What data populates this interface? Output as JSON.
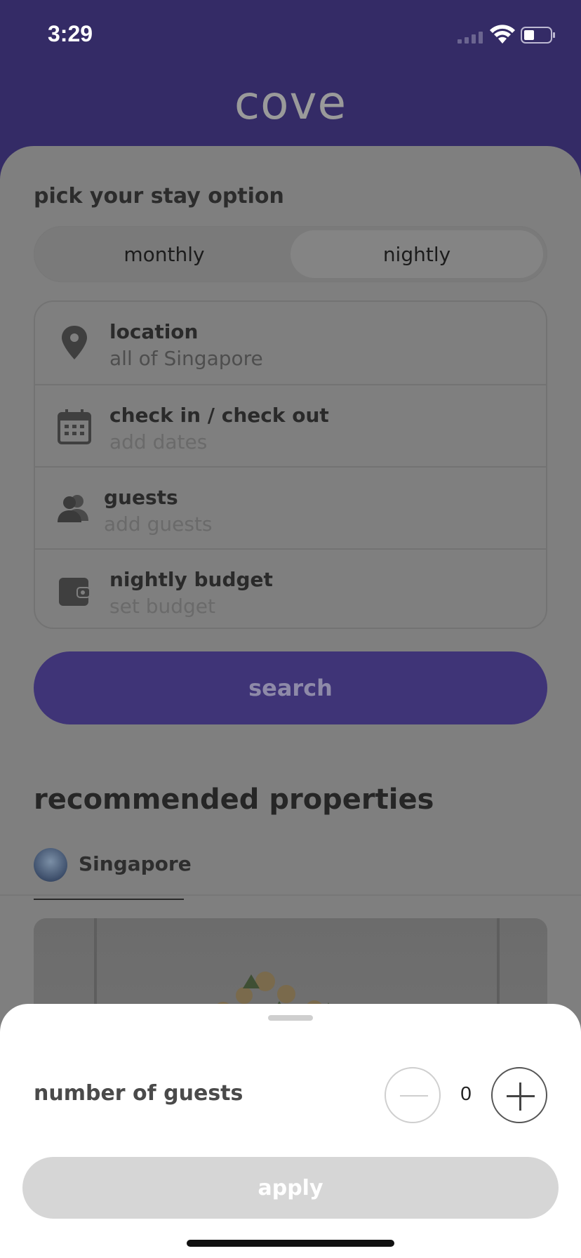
{
  "status_bar": {
    "time": "3:29"
  },
  "app": {
    "logo": "cove"
  },
  "stay": {
    "title": "pick your stay option",
    "options": [
      "monthly",
      "nightly"
    ],
    "selected": "nightly"
  },
  "search_form": {
    "location": {
      "label": "location",
      "value": "all of Singapore",
      "icon": "location-pin-icon"
    },
    "dates": {
      "label": "check in / check out",
      "placeholder": "add dates",
      "icon": "calendar-icon"
    },
    "guests": {
      "label": "guests",
      "placeholder": "add guests",
      "icon": "users-icon"
    },
    "budget": {
      "label": "nightly budget",
      "placeholder": "set budget",
      "icon": "wallet-icon"
    },
    "search_label": "search"
  },
  "recommended": {
    "title": "recommended properties",
    "tabs": [
      {
        "label": "Singapore"
      }
    ]
  },
  "guest_sheet": {
    "label": "number of guests",
    "count": "0",
    "apply_label": "apply"
  },
  "colors": {
    "brand_purple": "#342b66",
    "overlay_gray": "#7f7f7f",
    "disabled_button": "#d6d6d6"
  }
}
